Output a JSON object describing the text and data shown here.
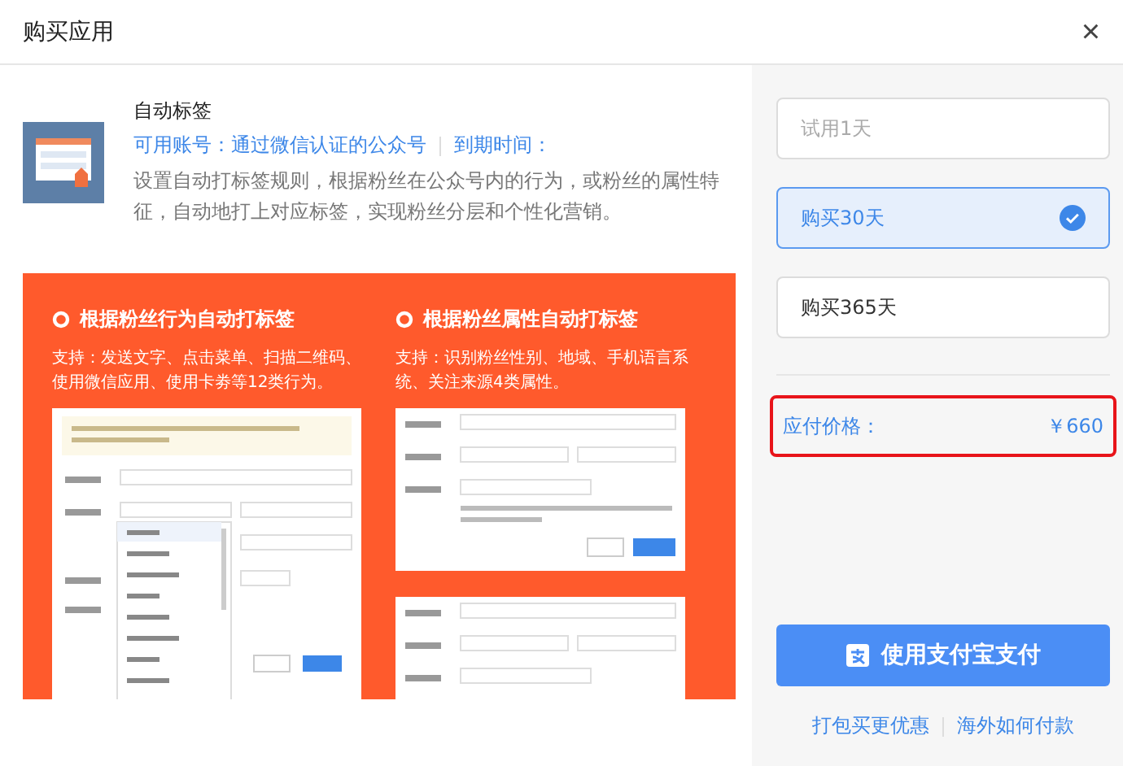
{
  "dialog": {
    "title": "购买应用",
    "close": "×"
  },
  "app": {
    "name": "自动标签",
    "account_label": "可用账号：通过微信认证的公众号",
    "expiry_label": "到期时间：",
    "description": "设置自动打标签规则，根据粉丝在公众号内的行为，或粉丝的属性特征，自动地打上对应标签，实现粉丝分层和个性化营销。"
  },
  "banner": {
    "columns": [
      {
        "heading": "根据粉丝行为自动打标签",
        "support": "支持：发送文字、点击菜单、扫描二维码、使用微信应用、使用卡劵等12类行为。",
        "kind": "behavior"
      },
      {
        "heading": "根据粉丝属性自动打标签",
        "support": "支持：识别粉丝性别、地域、手机语言系统、关注来源4类属性。",
        "kind": "attribute"
      }
    ]
  },
  "plans": [
    {
      "label": "试用1天",
      "selected": false,
      "disabled": true
    },
    {
      "label": "购买30天",
      "selected": true,
      "disabled": false
    },
    {
      "label": "购买365天",
      "selected": false,
      "disabled": false
    }
  ],
  "price": {
    "label": "应付价格：",
    "value": "￥660",
    "highlighted": true
  },
  "pay_button": "使用支付宝支付",
  "links": [
    "打包买更优惠",
    "海外如何付款"
  ]
}
